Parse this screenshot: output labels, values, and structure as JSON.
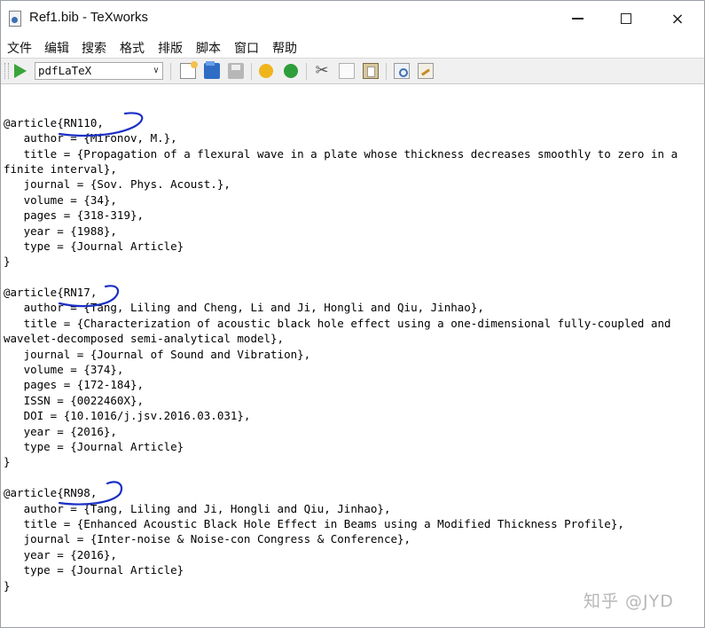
{
  "window": {
    "title": "Ref1.bib - TeXworks",
    "controls": {
      "minimize": "minimize",
      "maximize": "maximize",
      "close": "×"
    }
  },
  "menu": [
    "文件",
    "编辑",
    "搜索",
    "格式",
    "排版",
    "脚本",
    "窗口",
    "帮助"
  ],
  "toolbar": {
    "engine": "pdfLaTeX",
    "icons": [
      "play-icon",
      "new-icon",
      "open-icon",
      "save-icon",
      "undo-icon",
      "redo-icon",
      "cut-icon",
      "copy-icon",
      "paste-icon",
      "find-icon",
      "replace-icon"
    ]
  },
  "editor": {
    "lines": [
      "",
      "",
      "@article{RN110,",
      "   author = {Mironov, M.},",
      "   title = {Propagation of a flexural wave in a plate whose thickness decreases smoothly to zero in a",
      "finite interval},",
      "   journal = {Sov. Phys. Acoust.},",
      "   volume = {34},",
      "   pages = {318-319},",
      "   year = {1988},",
      "   type = {Journal Article}",
      "}",
      "",
      "@article{RN17,",
      "   author = {Tang, Liling and Cheng, Li and Ji, Hongli and Qiu, Jinhao},",
      "   title = {Characterization of acoustic black hole effect using a one-dimensional fully-coupled and",
      "wavelet-decomposed semi-analytical model},",
      "   journal = {Journal of Sound and Vibration},",
      "   volume = {374},",
      "   pages = {172-184},",
      "   ISSN = {0022460X},",
      "   DOI = {10.1016/j.jsv.2016.03.031},",
      "   year = {2016},",
      "   type = {Journal Article}",
      "}",
      "",
      "@article{RN98,",
      "   author = {Tang, Liling and Ji, Hongli and Qiu, Jinhao},",
      "   title = {Enhanced Acoustic Black Hole Effect in Beams using a Modified Thickness Profile},",
      "   journal = {Inter-noise & Noise-con Congress & Conference},",
      "   year = {2016},",
      "   type = {Journal Article}",
      "}"
    ]
  },
  "watermark": "知乎 @JYD",
  "colors": {
    "annotation": "#1a2fc4",
    "value_text": "#8b2a2a",
    "run_green": "#3aa43a"
  }
}
